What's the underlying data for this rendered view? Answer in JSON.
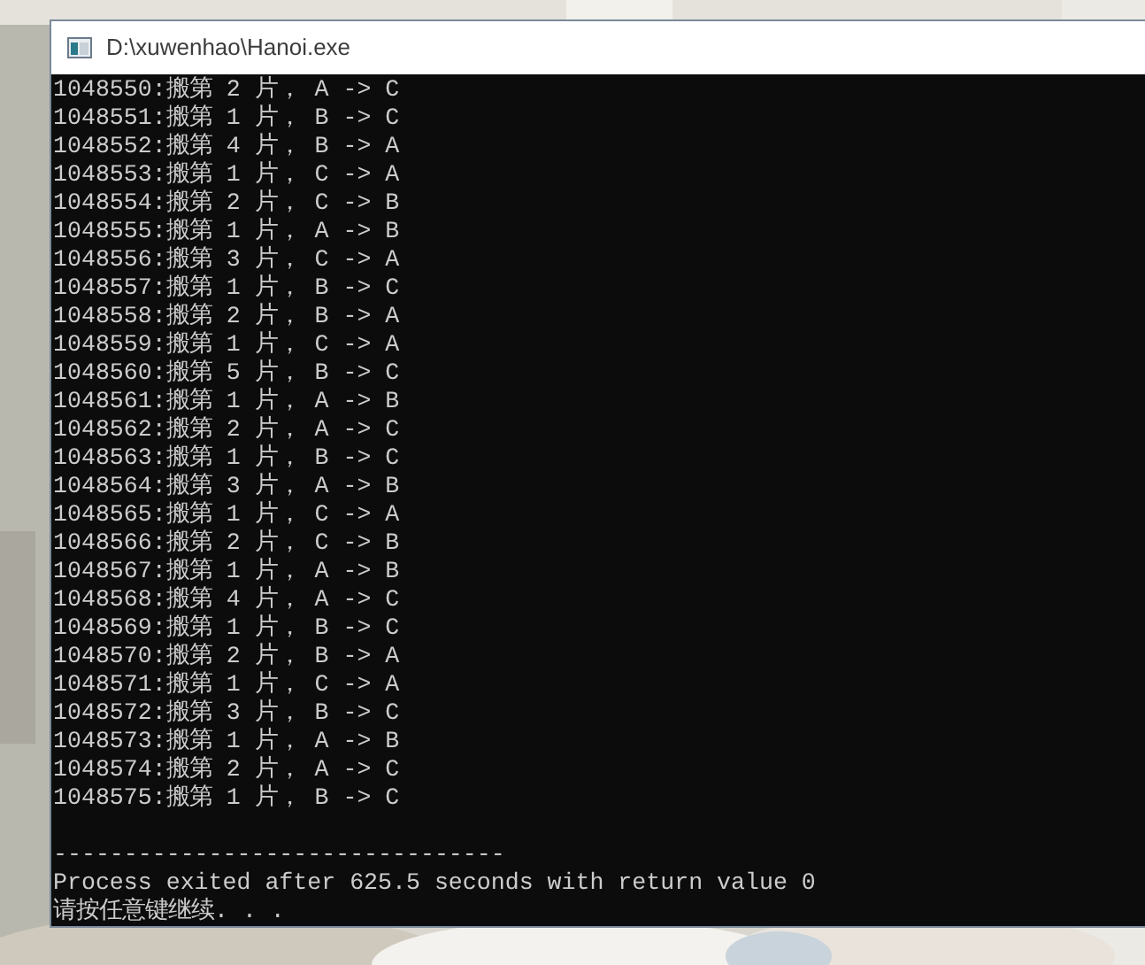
{
  "window": {
    "title": "D:\\xuwenhao\\Hanoi.exe"
  },
  "console": {
    "lines": [
      "1048550:搬第 2 片， A -> C",
      "1048551:搬第 1 片， B -> C",
      "1048552:搬第 4 片， B -> A",
      "1048553:搬第 1 片， C -> A",
      "1048554:搬第 2 片， C -> B",
      "1048555:搬第 1 片， A -> B",
      "1048556:搬第 3 片， C -> A",
      "1048557:搬第 1 片， B -> C",
      "1048558:搬第 2 片， B -> A",
      "1048559:搬第 1 片， C -> A",
      "1048560:搬第 5 片， B -> C",
      "1048561:搬第 1 片， A -> B",
      "1048562:搬第 2 片， A -> C",
      "1048563:搬第 1 片， B -> C",
      "1048564:搬第 3 片， A -> B",
      "1048565:搬第 1 片， C -> A",
      "1048566:搬第 2 片， C -> B",
      "1048567:搬第 1 片， A -> B",
      "1048568:搬第 4 片， A -> C",
      "1048569:搬第 1 片， B -> C",
      "1048570:搬第 2 片， B -> A",
      "1048571:搬第 1 片， C -> A",
      "1048572:搬第 3 片， B -> C",
      "1048573:搬第 1 片， A -> B",
      "1048574:搬第 2 片， A -> C",
      "1048575:搬第 1 片， B -> C"
    ],
    "separator": "--------------------------------",
    "footer_lines": [
      "Process exited after 625.5 seconds with return value 0",
      "请按任意键继续. . ."
    ]
  }
}
